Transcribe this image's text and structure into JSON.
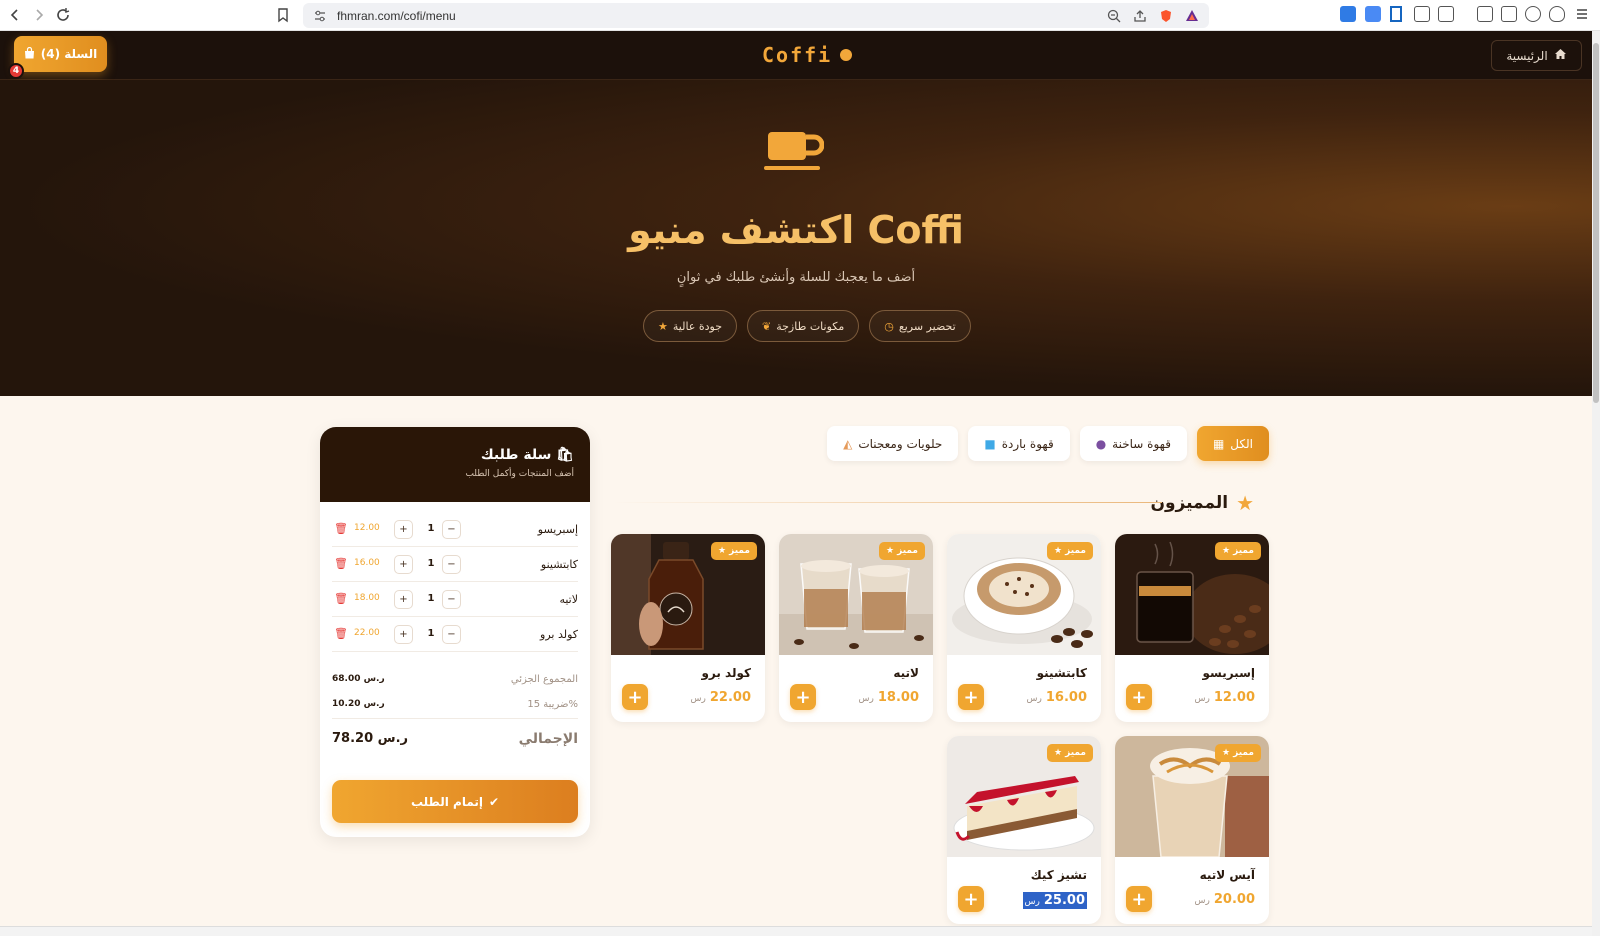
{
  "browser": {
    "url": "fhmran.com/cofi/menu"
  },
  "header": {
    "cart_label": "السلة (4)",
    "cart_count": "4",
    "logo": "Coffi",
    "home_label": "الرئيسية"
  },
  "hero": {
    "title": "اكتشف منيو Coffi",
    "subtitle": "أضف ما يعجبك للسلة وأنشئ طلبك في ثوانٍ",
    "pills": [
      {
        "label": "تحضير سريع",
        "icon": "clock-icon"
      },
      {
        "label": "مكونات طازجة",
        "icon": "leaf-icon"
      },
      {
        "label": "جودة عالية",
        "icon": "star-icon"
      }
    ]
  },
  "filters": [
    {
      "label": "الكل",
      "icon": "grid-icon",
      "active": true
    },
    {
      "label": "قهوة ساخنة",
      "icon": "hot-coffee-icon",
      "active": false
    },
    {
      "label": "قهوة باردة",
      "icon": "ice-cube-icon",
      "active": false
    },
    {
      "label": "حلويات ومعجنات",
      "icon": "cake-icon",
      "active": false
    }
  ],
  "section": {
    "title": "المميزون"
  },
  "products": [
    {
      "name": "إسبريسو",
      "price": "12.00",
      "currency": "رس",
      "badge": "مميز",
      "image": "espresso"
    },
    {
      "name": "كابتشينو",
      "price": "16.00",
      "currency": "رس",
      "badge": "مميز",
      "image": "cappuccino"
    },
    {
      "name": "لاتيه",
      "price": "18.00",
      "currency": "رس",
      "badge": "مميز",
      "image": "latte"
    },
    {
      "name": "كولد برو",
      "price": "22.00",
      "currency": "رس",
      "badge": "مميز",
      "image": "coldbrew"
    },
    {
      "name": "آيس لاتيه",
      "price": "20.00",
      "currency": "رس",
      "badge": "مميز",
      "image": "icelatte"
    },
    {
      "name": "تشيز كيك",
      "price": "25.00",
      "currency": "رس",
      "badge": "مميز",
      "image": "cheesecake",
      "selected": true
    }
  ],
  "cart": {
    "title": "سلة طلبك",
    "subtitle": "أضف المنتجات وأكمل الطلب",
    "items": [
      {
        "name": "إسبريسو",
        "qty": "1",
        "price": "12.00"
      },
      {
        "name": "كابتشينو",
        "qty": "1",
        "price": "16.00"
      },
      {
        "name": "لاتيه",
        "qty": "1",
        "price": "18.00"
      },
      {
        "name": "كولد برو",
        "qty": "1",
        "price": "22.00"
      }
    ],
    "subtotal_label": "المجموع الجزئي",
    "subtotal_value": "68.00 ر.س",
    "tax_label": "ضريبة 15%",
    "tax_value": "10.20 ر.س",
    "total_label": "الإجمالي",
    "total_value": "78.20 ر.س",
    "checkout_label": "إتمام الطلب"
  },
  "colors": {
    "accent": "#f0a630",
    "dark": "#1c110b",
    "cream": "#fdf6ee"
  }
}
